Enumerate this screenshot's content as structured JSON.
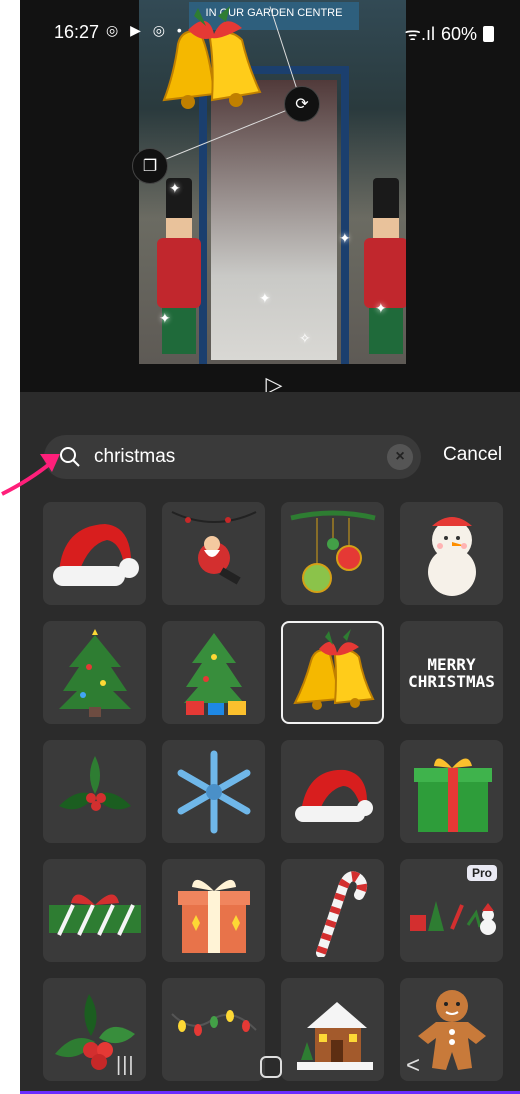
{
  "status_bar": {
    "time": "16:27",
    "left_icons": "◎ ▶ ◎ •",
    "battery_text": "60%",
    "signal_text": "ᯤ.ıl"
  },
  "preview": {
    "shop_sign": "IN OUR GARDEN CENTRE",
    "play_icon": "▷"
  },
  "search": {
    "query": "christmas",
    "cancel_label": "Cancel",
    "clear_icon": "×"
  },
  "stickers": [
    {
      "name": "santa-hat"
    },
    {
      "name": "santa-swing"
    },
    {
      "name": "ornaments"
    },
    {
      "name": "snowman"
    },
    {
      "name": "christmas-tree"
    },
    {
      "name": "christmas-tree-presents"
    },
    {
      "name": "christmas-bells",
      "selected": true
    },
    {
      "name": "merry-christmas-text",
      "text_line1": "MERRY",
      "text_line2": "CHRISTMAS"
    },
    {
      "name": "holly"
    },
    {
      "name": "snowflake"
    },
    {
      "name": "santa-hat-small"
    },
    {
      "name": "gift-box-green"
    },
    {
      "name": "ribbon-wrap"
    },
    {
      "name": "gift-box-orange"
    },
    {
      "name": "candy-cane"
    },
    {
      "name": "christmas-set",
      "badge": "Pro"
    },
    {
      "name": "holly-berries"
    },
    {
      "name": "string-lights"
    },
    {
      "name": "snowy-house"
    },
    {
      "name": "gingerbread-man"
    }
  ],
  "nav_bar": {
    "recent_icon": "|||",
    "back_icon": "<"
  },
  "colors": {
    "accent_pink": "#ff1f7a",
    "panel": "#2b2b2b",
    "tile": "#3a3a3a"
  }
}
